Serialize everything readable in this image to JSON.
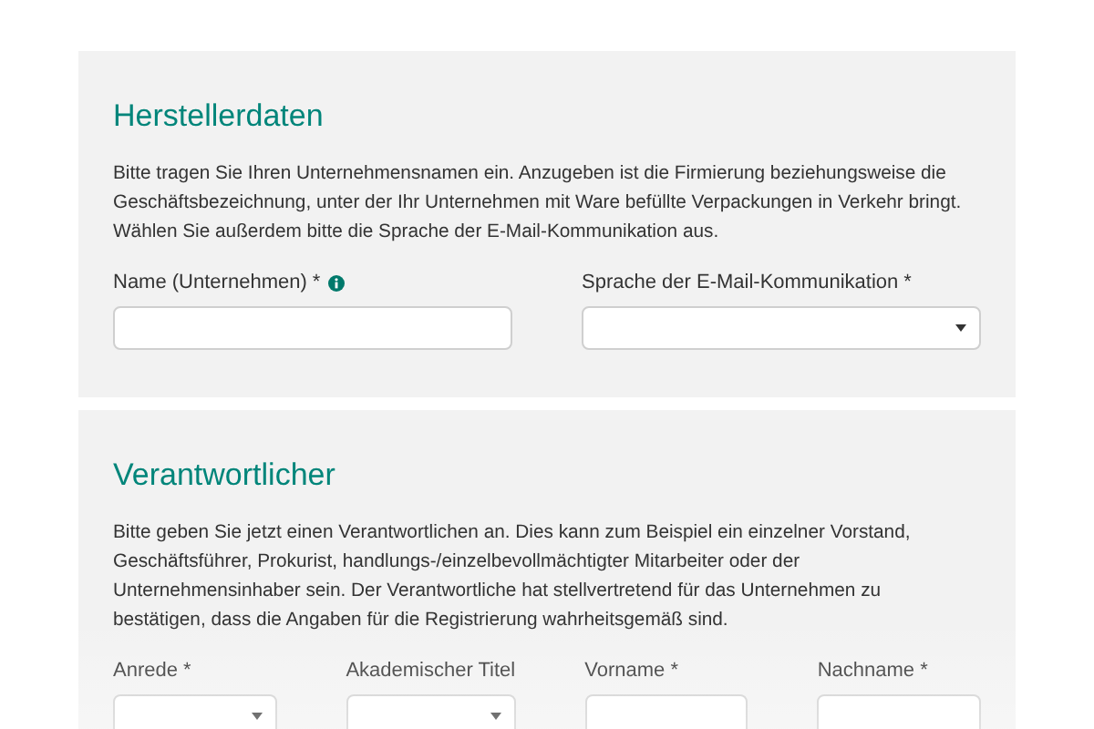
{
  "sections": [
    {
      "title": "Herstellerdaten",
      "description": "Bitte tragen Sie Ihren Unternehmensnamen ein. Anzugeben ist die Firmierung beziehungsweise die Geschäftsbezeichnung, unter der Ihr Unternehmen mit Ware befüllte Verpackungen in Verkehr bringt. Wählen Sie außerdem bitte die Sprache der E-Mail-Kommunikation aus.",
      "fields": [
        {
          "label": "Name (Unternehmen) *",
          "kind": "text",
          "info": true
        },
        {
          "label": "Sprache der E-Mail-Kommunikation *",
          "kind": "select"
        }
      ]
    },
    {
      "title": "Verantwortlicher",
      "description": "Bitte geben Sie jetzt einen Verantwortlichen an. Dies kann zum Beispiel ein einzelner Vorstand, Geschäftsführer, Prokurist, handlungs-/einzelbevollmächtigter Mitarbeiter oder der Unternehmensinhaber sein. Der Verantwortliche hat stellvertretend für das Unternehmen zu bestätigen, dass die Angaben für die Registrierung wahrheitsgemäß sind.",
      "fields": [
        {
          "label": "Anrede *",
          "kind": "select"
        },
        {
          "label": "Akademischer Titel",
          "kind": "select"
        },
        {
          "label": "Vorname *",
          "kind": "text"
        },
        {
          "label": "Nachname *",
          "kind": "text"
        }
      ]
    }
  ]
}
